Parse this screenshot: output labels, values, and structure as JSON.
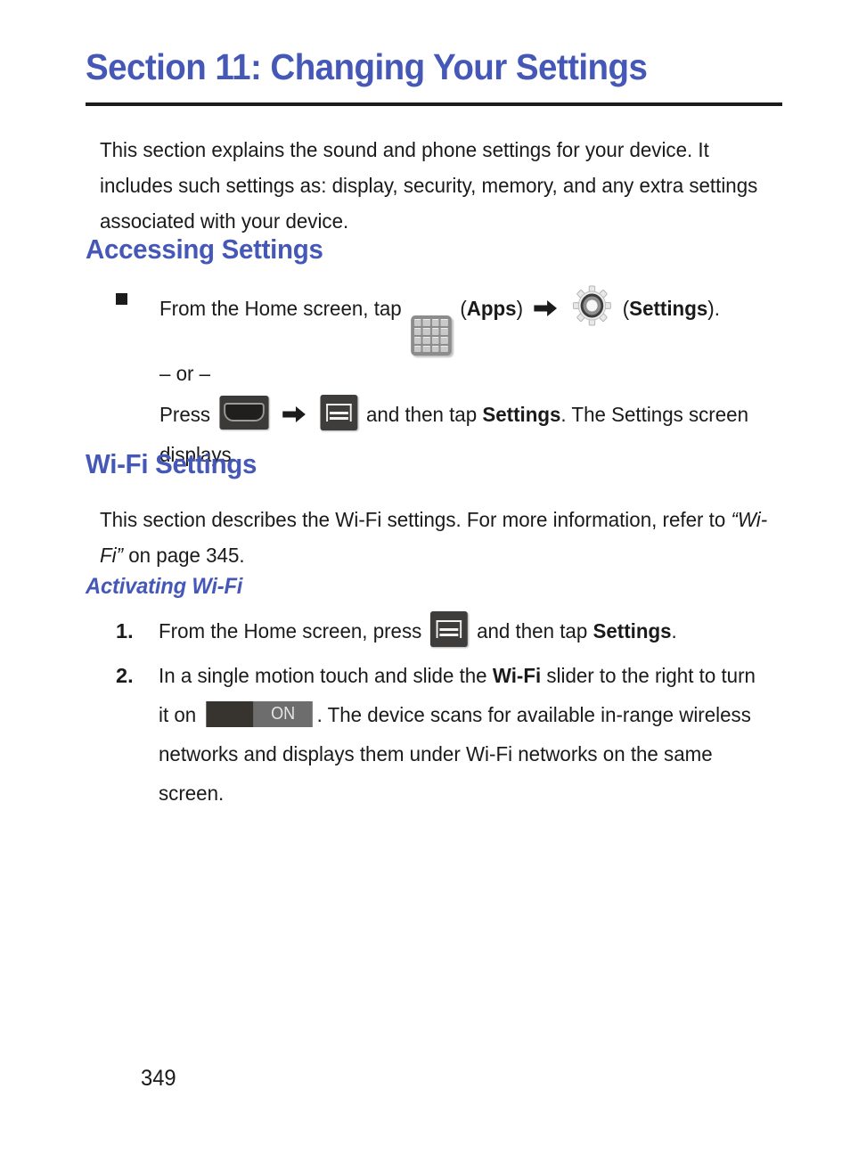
{
  "document": {
    "title": "Section 11: Changing Your Settings",
    "page_number": "349",
    "accent_color": "#4558b8",
    "text_color": "#1a1a1a"
  },
  "intro": {
    "paragraph": "This section explains the sound and phone settings for your device. It includes such settings as: display, security, memory, and any extra settings associated with your device."
  },
  "accessing_settings": {
    "heading": "Accessing Settings",
    "bullet": {
      "lead": "From the Home screen, tap",
      "apps_open_paren": "(",
      "apps_label": "Apps",
      "apps_close_paren": ")",
      "settings_open_paren": "(",
      "settings_label": "Settings",
      "settings_close_paren": ").",
      "or_text": "– or –",
      "press_lead": "Press",
      "press_tail_1": "and then tap",
      "press_bold": "Settings",
      "press_tail_2": ". The Settings screen displays."
    }
  },
  "wifi_settings": {
    "heading": "Wi-Fi Settings",
    "paragraph_part_1": "This section describes the Wi-Fi settings. For more information, refer to",
    "paragraph_quoted": "“Wi-Fi”",
    "paragraph_part_2": "on page 345.",
    "sub_heading": "Activating Wi-Fi",
    "steps": [
      {
        "number": "1.",
        "text_1": "From the Home screen, press",
        "text_2": "and then tap",
        "bold_1": "Settings",
        "text_3": "."
      },
      {
        "number": "2.",
        "text_1": "In a single motion touch and slide the",
        "bold_1": "Wi-Fi",
        "text_2": "slider to the right to turn it on",
        "text_3": ". The device scans for available in-range wireless networks and displays them under Wi-Fi networks on the same screen."
      }
    ]
  },
  "icons": {
    "apps": "apps-grid-icon",
    "settings": "gear-icon",
    "home_key": "home-key-icon",
    "menu_key": "menu-key-icon",
    "arrow": "right-arrow-icon",
    "bullet": "square-bullet"
  },
  "slider": {
    "label": "ON",
    "off_color": "#37342f",
    "on_color": "#6d6d6d"
  }
}
